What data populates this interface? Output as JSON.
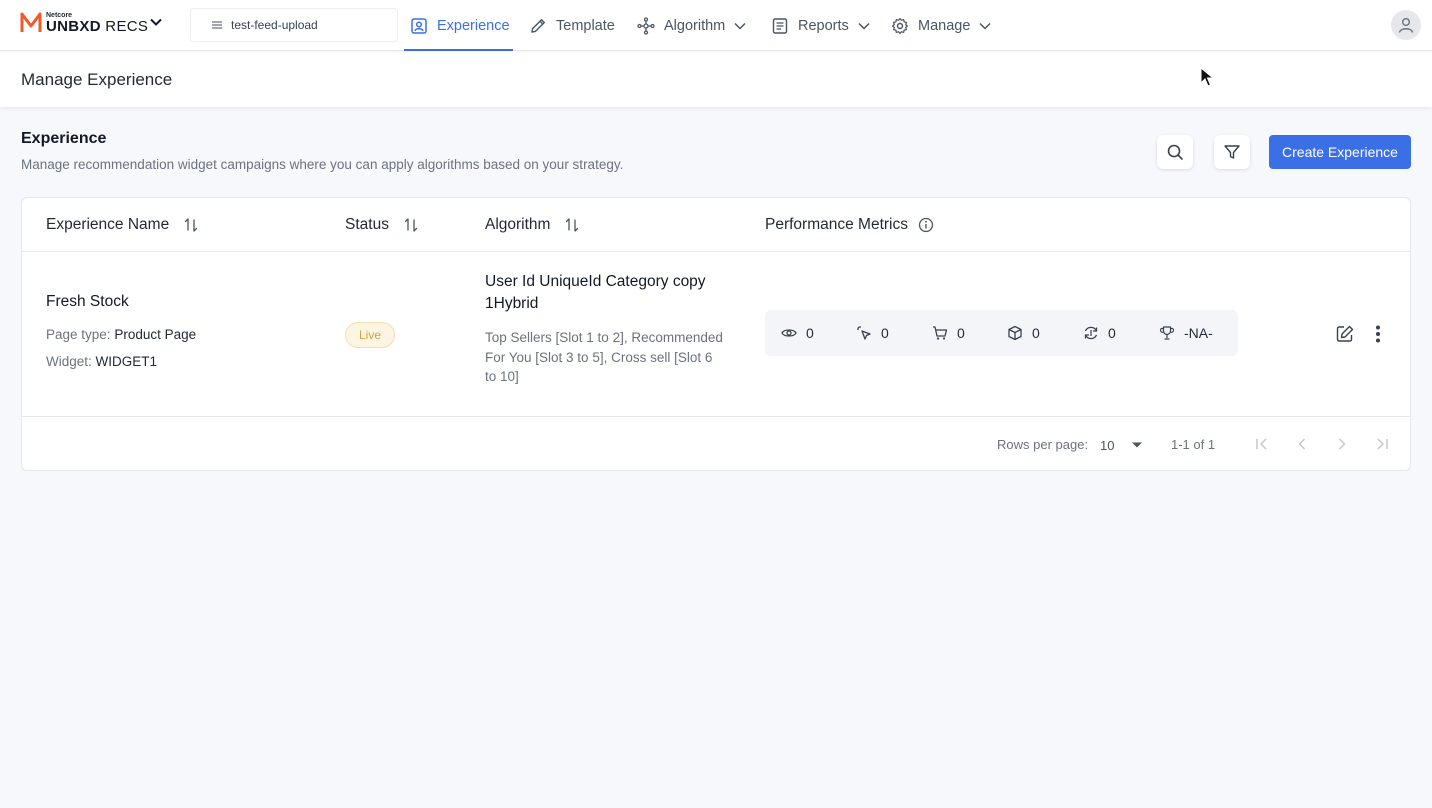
{
  "brand": {
    "small": "Netcore",
    "main": "UNBXD",
    "suffix": " RECS",
    "accent": "#f05a28"
  },
  "feed_selector": {
    "value": "test-feed-upload"
  },
  "nav": {
    "experience": "Experience",
    "template": "Template",
    "algorithm": "Algorithm",
    "reports": "Reports",
    "manage": "Manage"
  },
  "page_title": "Manage Experience",
  "section": {
    "title": "Experience",
    "description": "Manage recommendation widget campaigns where you can apply algorithms based on your strategy.",
    "create_label": "Create Experience"
  },
  "table": {
    "columns": {
      "name": "Experience Name",
      "status": "Status",
      "algorithm": "Algorithm",
      "metrics": "Performance Metrics"
    },
    "rows": [
      {
        "name": "Fresh Stock",
        "page_type_label": "Page type:",
        "page_type": "Product Page",
        "widget_label": "Widget:",
        "widget": "WIDGET1",
        "status": "Live",
        "algorithm_name": "User Id UniqueId Category copy 1Hybrid",
        "algorithm_slots": "Top Sellers [Slot 1 to 2], Recommended For You [Slot 3 to 5], Cross sell [Slot 6 to 10]",
        "metrics": {
          "views": "0",
          "clicks": "0",
          "add_to_cart": "0",
          "orders": "0",
          "conversions": "0",
          "revenue": "-NA-"
        }
      }
    ]
  },
  "pagination": {
    "rows_per_page_label": "Rows per page:",
    "rows_per_page": "10",
    "range": "1-1 of 1"
  },
  "colors": {
    "primary": "#3b6fe6",
    "live_badge_bg": "#fdf5e3",
    "live_badge_text": "#d4a23d"
  }
}
